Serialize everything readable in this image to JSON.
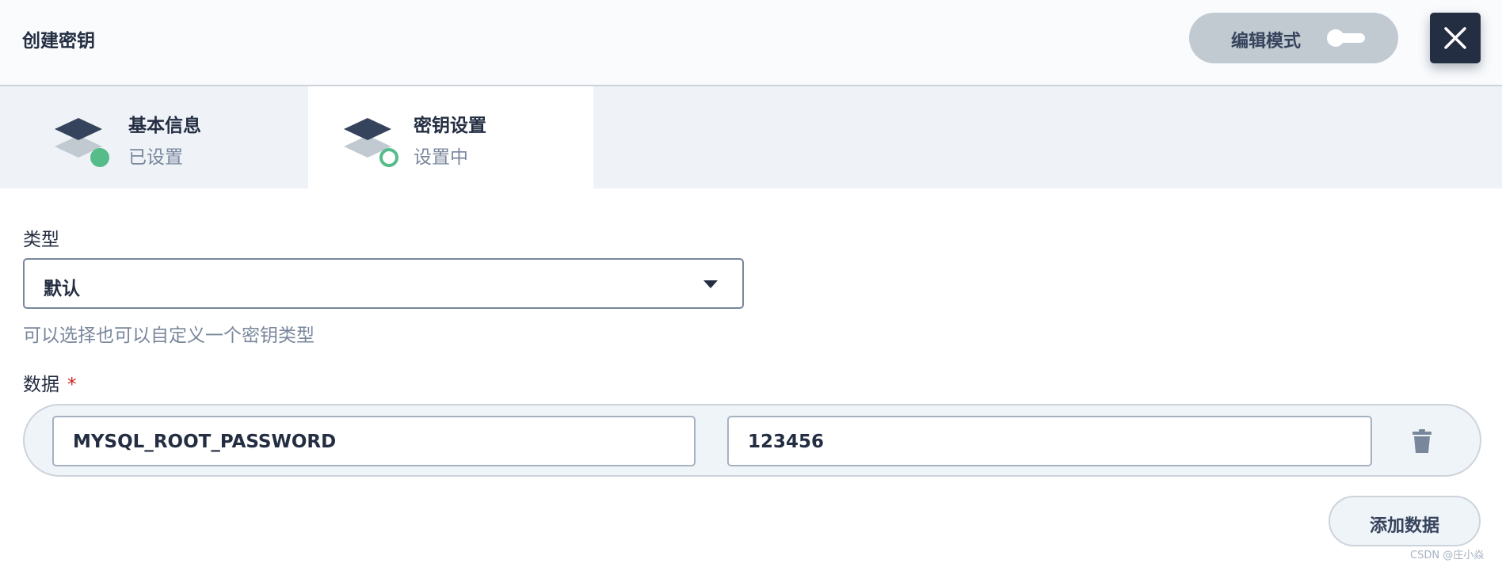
{
  "header": {
    "title": "创建密钥",
    "edit_mode_label": "编辑模式",
    "edit_mode_on": false,
    "close_icon": "close-icon"
  },
  "steps": [
    {
      "title": "基本信息",
      "status": "已设置",
      "state": "done",
      "icon": "layers-icon"
    },
    {
      "title": "密钥设置",
      "status": "设置中",
      "state": "in-progress",
      "icon": "layers-icon"
    }
  ],
  "form": {
    "type_label": "类型",
    "type_value": "默认",
    "type_hint": "可以选择也可以自定义一个密钥类型",
    "data_label": "数据",
    "required_mark": "*",
    "data_rows": [
      {
        "key": "MYSQL_ROOT_PASSWORD",
        "value": "123456",
        "delete_icon": "trash-icon"
      }
    ],
    "add_button_label": "添加数据"
  },
  "watermark": "CSDN @庄小焱",
  "colors": {
    "primary_dark": "#242e42",
    "success_green": "#55bc8a",
    "muted_text": "#79879c",
    "border": "#ccd3db"
  }
}
